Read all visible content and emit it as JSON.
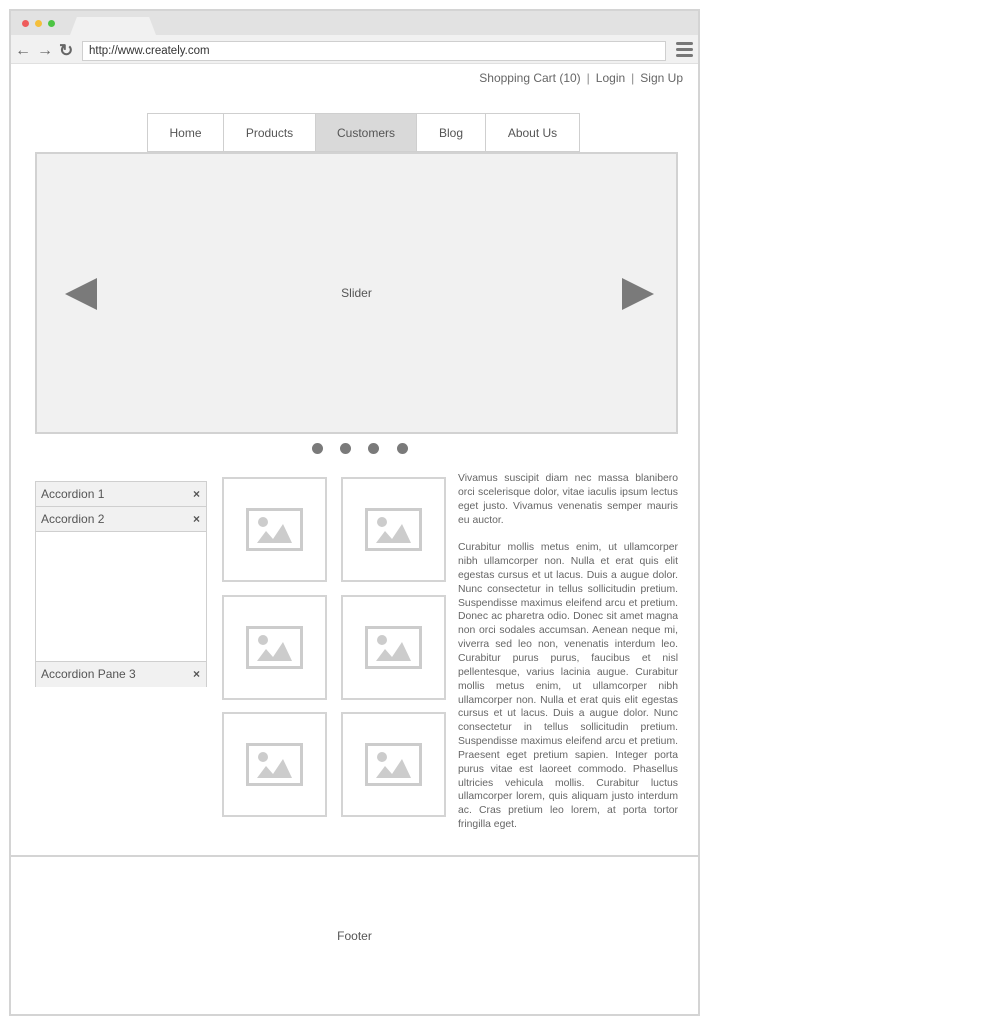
{
  "browser": {
    "url": "http://www.creately.com",
    "traffic_lights": [
      "#ee5c5c",
      "#f4bf3b",
      "#4cc443"
    ],
    "nav_icons": [
      "back-arrow-icon",
      "forward-arrow-icon",
      "reload-icon"
    ],
    "menu_icon": "hamburger-menu-icon"
  },
  "top_links": {
    "cart": "Shopping Cart (10)",
    "separator": "|",
    "login": "Login",
    "signup": "Sign Up"
  },
  "nav": {
    "items": [
      {
        "label": "Home",
        "active": false
      },
      {
        "label": "Products",
        "active": false
      },
      {
        "label": "Customers",
        "active": true
      },
      {
        "label": "Blog",
        "active": false
      },
      {
        "label": "About Us",
        "active": false
      }
    ]
  },
  "slider": {
    "label": "Slider",
    "prev_icon": "triangle-left-icon",
    "next_icon": "triangle-right-icon",
    "dot_count": 4
  },
  "accordion": {
    "items": [
      {
        "label": "Accordion 1",
        "close": "×"
      },
      {
        "label": "Accordion 2",
        "close": "×"
      },
      {
        "label": "Accordion Pane 3",
        "close": "×"
      }
    ]
  },
  "gallery": {
    "count": 6,
    "icon": "image-placeholder-icon"
  },
  "body_text": {
    "paragraphs": [
      "Vivamus suscipit diam nec massa blanibero orci scelerisque dolor, vitae iaculis ipsum lectus eget justo. Vivamus venenatis semper mauris eu auctor.",
      "Curabitur mollis metus enim, ut ullamcorper nibh ullamcorper non. Nulla et erat quis elit egestas cursus et ut lacus. Duis a augue dolor. Nunc consectetur in tellus sollicitudin pretium. Suspendisse maximus eleifend arcu et pretium. Donec ac pharetra odio. Donec sit amet magna non orci sodales accumsan. Aenean neque mi, viverra sed leo non, venenatis interdum leo. Curabitur purus purus, faucibus et nisl pellentesque, varius lacinia augue. Curabitur mollis metus enim, ut ullamcorper nibh ullamcorper non. Nulla et erat quis elit egestas cursus et ut lacus. Duis a augue dolor. Nunc consectetur in tellus sollicitudin pretium. Suspendisse maximus eleifend arcu et pretium. Praesent eget pretium sapien. Integer porta purus vitae est laoreet commodo. Phasellus ultricies vehicula mollis. Curabitur luctus ullamcorper lorem, quis aliquam justo interdum ac. Cras pretium leo lorem, at porta tortor fringilla eget."
    ]
  },
  "footer": {
    "label": "Footer"
  },
  "colors": {
    "border": "#d4d4d4",
    "panel": "#f1f1f1",
    "active_tab": "#d9d9d9",
    "icon_gray": "#7a7a7a",
    "placeholder_gray": "#cccccc"
  }
}
